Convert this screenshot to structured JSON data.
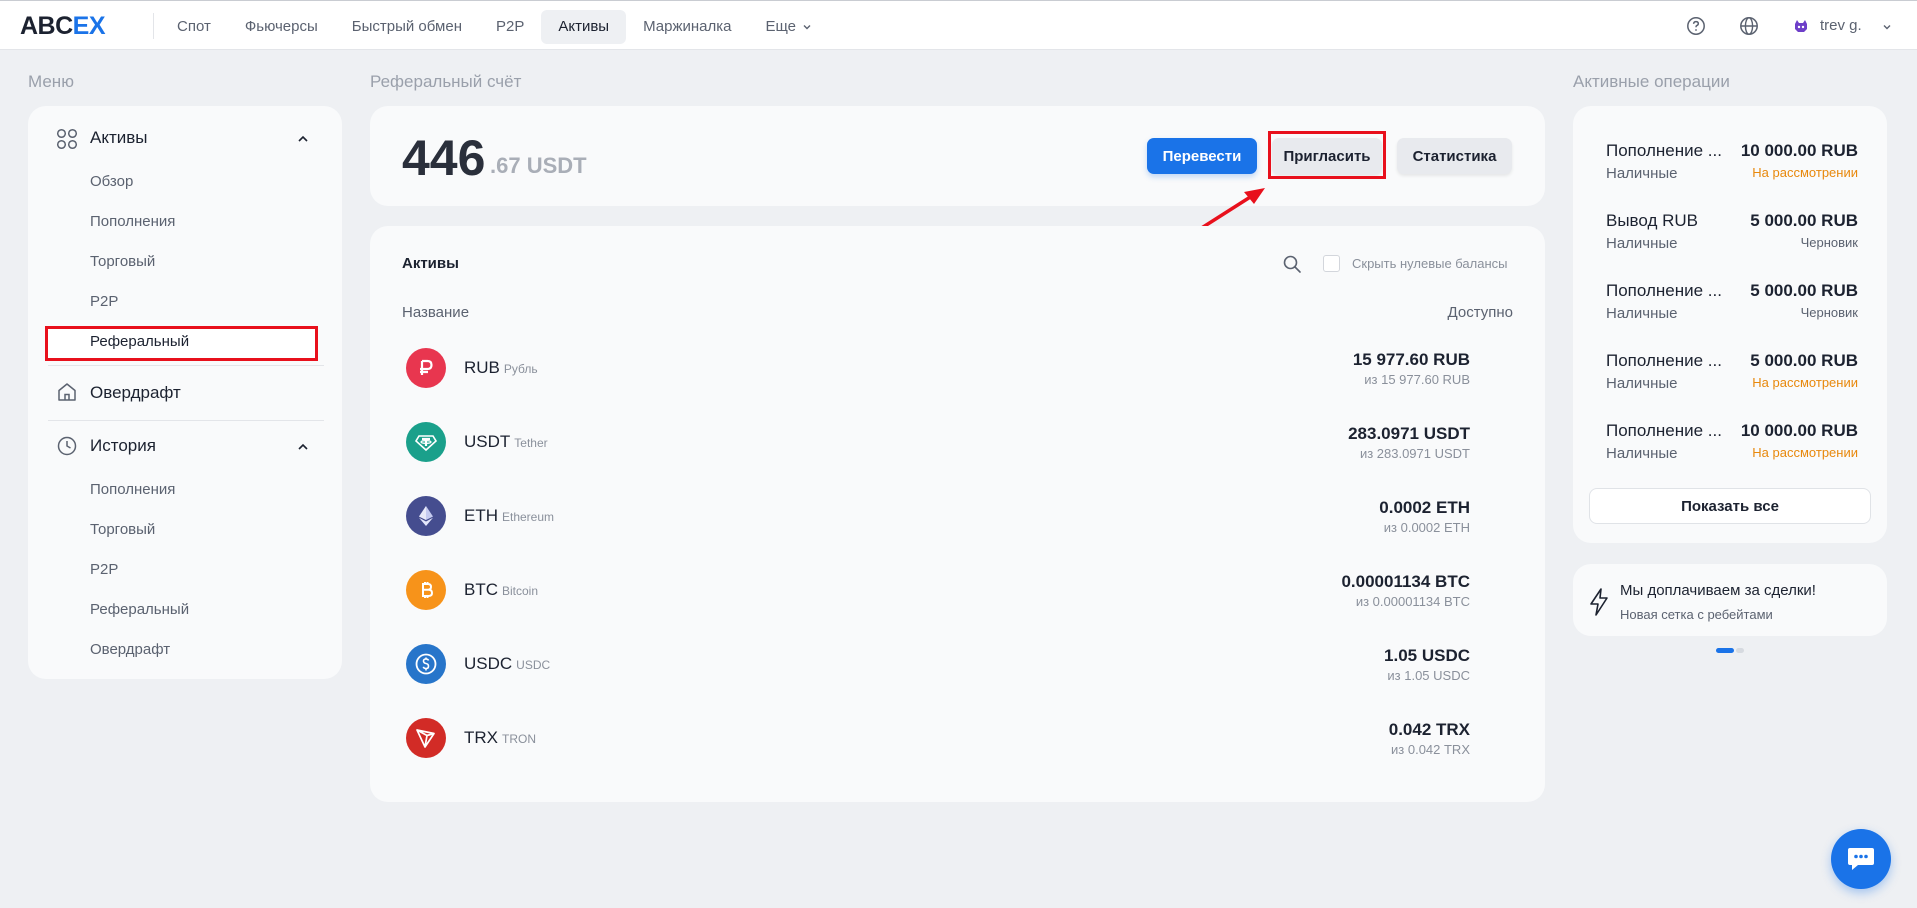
{
  "app": {
    "logo_part1": "ABC",
    "logo_part2": "EX",
    "nav": [
      "Спот",
      "Фьючерсы",
      "Быстрый обмен",
      "P2P",
      "Активы",
      "Маржиналка",
      "Еще"
    ],
    "user_name": "trev g."
  },
  "sidebar": {
    "title": "Меню",
    "assets_head": "Активы",
    "assets_items": [
      "Обзор",
      "Пополнения",
      "Торговый",
      "P2P",
      "Реферальный"
    ],
    "overdraft": "Овердрафт",
    "history_head": "История",
    "history_items": [
      "Пополнения",
      "Торговый",
      "P2P",
      "Реферальный",
      "Овердрафт"
    ]
  },
  "referral": {
    "title": "Реферальный счёт",
    "balance_int": "446",
    "balance_dec": ".67 USDT",
    "transfer_label": "Перевести",
    "invite_label": "Пригласить",
    "stats_label": "Статистика"
  },
  "assets": {
    "title": "Активы",
    "hide_zero": "Скрыть нулевые балансы",
    "col_name": "Название",
    "col_available": "Доступно",
    "rows": [
      {
        "symbol": "RUB",
        "name": "Рубль",
        "amount": "15 977.60 RUB",
        "sub": "из 15 977.60 RUB",
        "color": "#e8364f"
      },
      {
        "symbol": "USDT",
        "name": "Tether",
        "amount": "283.0971 USDT",
        "sub": "из 283.0971 USDT",
        "color": "#1aa08b"
      },
      {
        "symbol": "ETH",
        "name": "Ethereum",
        "amount": "0.0002 ETH",
        "sub": "из 0.0002 ETH",
        "color": "#454d8f"
      },
      {
        "symbol": "BTC",
        "name": "Bitcoin",
        "amount": "0.00001134 BTC",
        "sub": "из 0.00001134 BTC",
        "color": "#f7931a"
      },
      {
        "symbol": "USDC",
        "name": "USDC",
        "amount": "1.05 USDC",
        "sub": "из 1.05 USDC",
        "color": "#2775ca"
      },
      {
        "symbol": "TRX",
        "name": "TRON",
        "amount": "0.042 TRX",
        "sub": "из 0.042 TRX",
        "color": "#d22b26"
      }
    ]
  },
  "operations": {
    "title": "Активные операции",
    "items": [
      {
        "title": "Пополнение ...",
        "amount": "10 000.00 RUB",
        "method": "Наличные",
        "status": "На рассмотрении",
        "status_color": "#e8880c"
      },
      {
        "title": "Вывод RUB",
        "amount": "5 000.00 RUB",
        "method": "Наличные",
        "status": "Черновик",
        "status_color": "#5b6270"
      },
      {
        "title": "Пополнение ...",
        "amount": "5 000.00 RUB",
        "method": "Наличные",
        "status": "Черновик",
        "status_color": "#5b6270"
      },
      {
        "title": "Пополнение ...",
        "amount": "5 000.00 RUB",
        "method": "Наличные",
        "status": "На рассмотрении",
        "status_color": "#e8880c"
      },
      {
        "title": "Пополнение ...",
        "amount": "10 000.00 RUB",
        "method": "Наличные",
        "status": "На рассмотрении",
        "status_color": "#e8880c"
      }
    ],
    "show_all": "Показать все"
  },
  "promo": {
    "title": "Мы доплачиваем за сделки!",
    "subtitle": "Новая сетка с ребейтами"
  },
  "colors": {
    "accent": "#1a73e8",
    "highlight": "#e8101c",
    "pending": "#e8880c"
  }
}
